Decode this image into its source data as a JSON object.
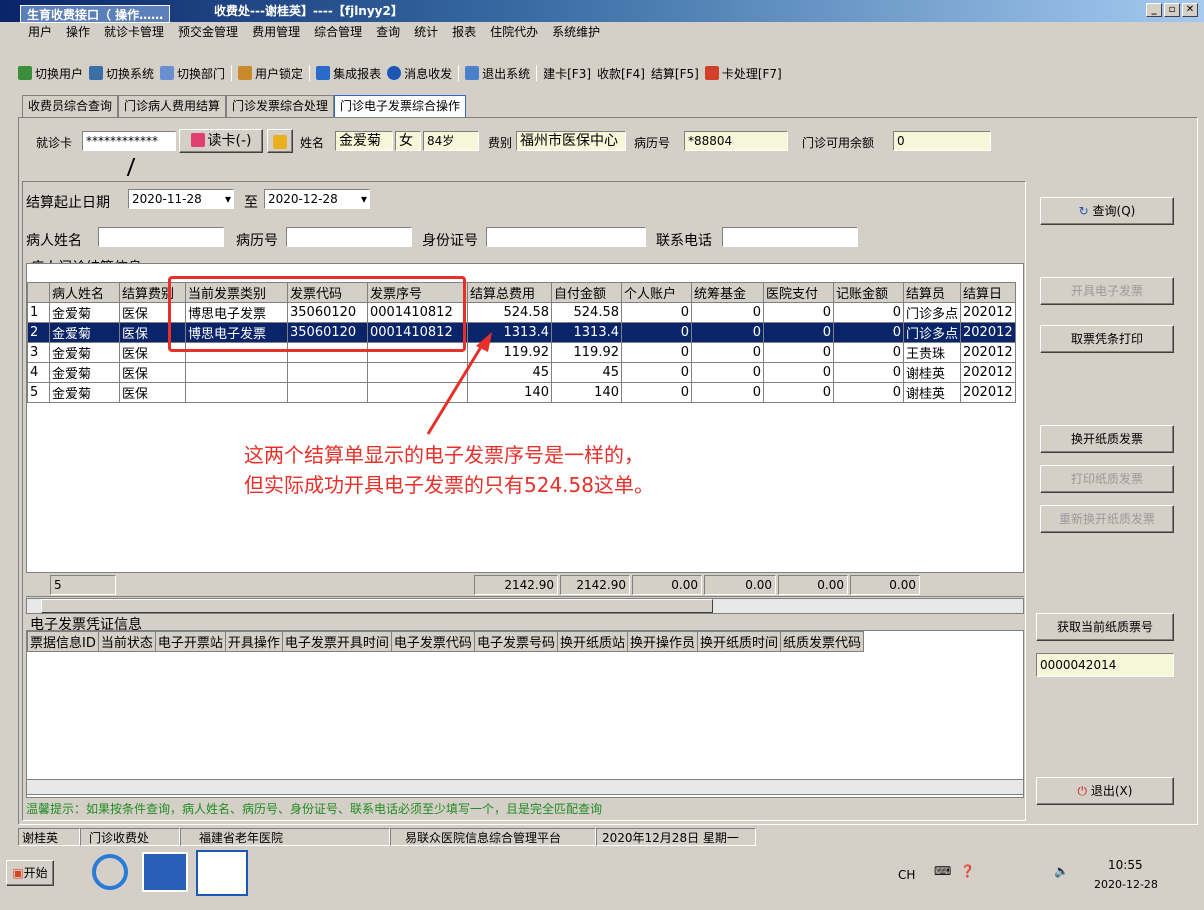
{
  "window": {
    "title": "收费处---谢桂英】----【fjlnyy2】",
    "float_tag": "生育收费接口（ 操作……",
    "buttons": [
      "_",
      "▫",
      "✕"
    ]
  },
  "menu": [
    "用户",
    "操作",
    "就诊卡管理",
    "预交金管理",
    "费用管理",
    "综合管理",
    "查询",
    "统计",
    "报表",
    "住院代办",
    "系统维护"
  ],
  "toolbar": [
    "切换用户",
    "切换系统",
    "切换部门",
    "用户锁定",
    "集成报表",
    "消息收发",
    "退出系统",
    "建卡[F3]",
    "收款[F4]",
    "结算[F5]",
    "卡处理[F7]"
  ],
  "tabs": [
    "收费员综合查询",
    "门诊病人费用结算",
    "门诊发票综合处理",
    "门诊电子发票综合操作"
  ],
  "patient": {
    "card_label": "就诊卡",
    "card_value": "************",
    "read_card": "读卡(-)",
    "name_label": "姓名",
    "name": "金爱菊",
    "sex": "女",
    "age": "84岁",
    "type_label": "费别",
    "type": "福州市医保中心",
    "record_label": "病历号",
    "record": "*88804",
    "balance_label": "门诊可用余额",
    "balance": "0"
  },
  "filters": {
    "date_label": "结算起止日期",
    "date_from": "2020-11-28",
    "to": "至",
    "date_to": "2020-12-28",
    "name_label": "病人姓名",
    "record_label": "病历号",
    "id_label": "身份证号",
    "phone_label": "联系电话"
  },
  "grid1": {
    "title": "病人门诊结算信息",
    "headers": [
      "",
      "病人姓名",
      "结算费别",
      "当前发票类别",
      "发票代码",
      "发票序号",
      "结算总费用",
      "自付金额",
      "个人账户",
      "统筹基金",
      "医院支付",
      "记账金额",
      "结算员",
      "结算日"
    ],
    "rows": [
      [
        "1",
        "金爱菊",
        "医保",
        "博思电子发票",
        "35060120",
        "0001410812",
        "524.58",
        "524.58",
        "0",
        "0",
        "0",
        "0",
        "门诊多点",
        "202012"
      ],
      [
        "2",
        "金爱菊",
        "医保",
        "博思电子发票",
        "35060120",
        "0001410812",
        "1313.4",
        "1313.4",
        "0",
        "0",
        "0",
        "0",
        "门诊多点",
        "202012"
      ],
      [
        "3",
        "金爱菊",
        "医保",
        "",
        "",
        "",
        "119.92",
        "119.92",
        "0",
        "0",
        "0",
        "0",
        "王贵珠",
        "202012"
      ],
      [
        "4",
        "金爱菊",
        "医保",
        "",
        "",
        "",
        "45",
        "45",
        "0",
        "0",
        "0",
        "0",
        "谢桂英",
        "202012"
      ],
      [
        "5",
        "金爱菊",
        "医保",
        "",
        "",
        "",
        "140",
        "140",
        "0",
        "0",
        "0",
        "0",
        "谢桂英",
        "202012"
      ]
    ],
    "footer": {
      "count": "5",
      "total": "2142.90",
      "self": "2142.90",
      "acct": "0.00",
      "fund": "0.00",
      "hosp": "0.00",
      "bill": "0.00"
    }
  },
  "grid2": {
    "title": "电子发票凭证信息",
    "headers": [
      "票据信息ID",
      "当前状态",
      "电子开票站",
      "开具操作",
      "电子发票开具时间",
      "电子发票代码",
      "电子发票号码",
      "换开纸质站",
      "换开操作员",
      "换开纸质时间",
      "纸质发票代码"
    ]
  },
  "hint": "温馨提示：如果按条件查询，病人姓名、病历号、身份证号、联系电话必须至少填写一个，且是完全匹配查询",
  "annotation": [
    "这两个结算单显示的电子发票序号是一样的，",
    "但实际成功开具电子发票的只有524.58这单。"
  ],
  "right_buttons": {
    "query": "查询(Q)",
    "issue": "开具电子发票",
    "print_receipt": "取票凭条打印",
    "swap_paper": "换开纸质发票",
    "print_paper": "打印纸质发票",
    "reswap": "重新换开纸质发票",
    "get_paper_no": "获取当前纸质票号",
    "paper_no": "0000042014",
    "exit": "退出(X)"
  },
  "status": [
    "谢桂英",
    "门诊收费处",
    "福建省老年医院",
    "易联众医院信息综合管理平台",
    "2020年12月28日 星期一"
  ],
  "taskbar": {
    "start": "开始",
    "lang": "CH",
    "time": "10:55",
    "date": "2020-12-28"
  }
}
